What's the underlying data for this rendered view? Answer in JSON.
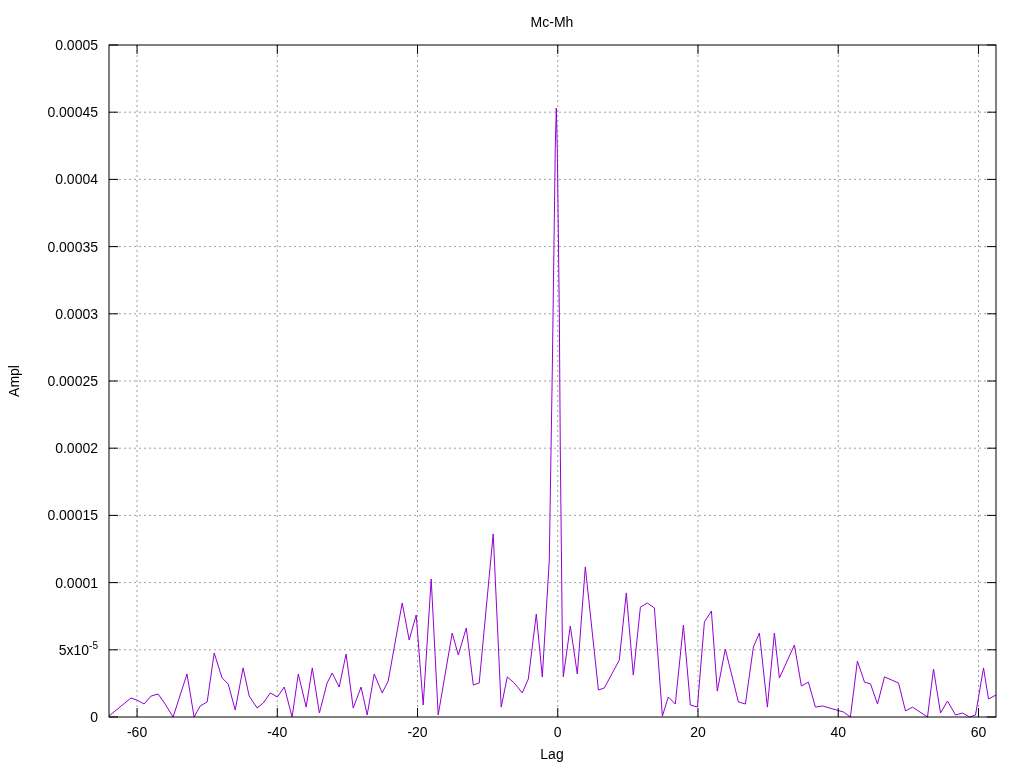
{
  "chart_data": {
    "type": "line",
    "title": "Mc-Mh",
    "xlabel": "Lag",
    "ylabel": "Ampl",
    "grid": true,
    "xlim": [
      -64,
      62.5
    ],
    "ylim": [
      0,
      0.0005
    ],
    "xticks": [
      -60,
      -40,
      -20,
      0,
      20,
      40,
      60
    ],
    "yticks": [
      0,
      {
        "value": 5e-05,
        "label": "5x10$^{-5}$"
      },
      {
        "value": 0.0001,
        "label": "0.0001"
      },
      {
        "value": 0.00015,
        "label": "0.00015"
      },
      {
        "value": 0.0002,
        "label": "0.0002"
      },
      {
        "value": 0.00025,
        "label": "0.00025"
      },
      {
        "value": 0.0003,
        "label": "0.0003"
      },
      {
        "value": 0.00035,
        "label": "0.00035"
      },
      {
        "value": 0.0004,
        "label": "0.0004"
      },
      {
        "value": 0.00045,
        "label": "0.00045"
      },
      {
        "value": 0.0005,
        "label": "0.0005"
      }
    ],
    "x": [
      -64,
      -60.86,
      -60,
      -59,
      -58,
      -57,
      -56,
      -54.86,
      -52.87,
      -51.87,
      -51,
      -50,
      -49,
      -47.87,
      -47,
      -46,
      -44.87,
      -44,
      -42.88,
      -42,
      -41,
      -40,
      -39,
      -37.88,
      -37,
      -35.88,
      -35,
      -34,
      -32.89,
      -32.17,
      -31.17,
      -30.18,
      -29.18,
      -28.04,
      -27.18,
      -26.18,
      -25.04,
      -24.18,
      -22.18,
      -21.18,
      -20.19,
      -19.19,
      -18.05,
      -17.05,
      -15.05,
      -14.19,
      -13.05,
      -12.05,
      -11.2,
      -9.2,
      -8.06,
      -7.2,
      -6.2,
      -5.06,
      -4.2,
      -3.06,
      -2.21,
      -1.21,
      -0.78,
      -0.64,
      -0.49,
      -0.35,
      -0.21,
      -0.07,
      0.08,
      0.22,
      0.36,
      0.65,
      0.79,
      1.79,
      2.79,
      3.93,
      5.79,
      6.64,
      8.78,
      9.78,
      10.78,
      11.78,
      12.78,
      13.78,
      14.92,
      15.77,
      16.77,
      17.92,
      18.91,
      19.91,
      20.91,
      21.91,
      22.76,
      23.9,
      25.76,
      26.76,
      27.9,
      28.76,
      29.9,
      30.9,
      31.61,
      33.75,
      34.75,
      35.75,
      36.75,
      37.75,
      39.75,
      40.75,
      41.74,
      42.74,
      43.74,
      44.6,
      45.6,
      46.6,
      48.6,
      49.6,
      50.59,
      52.73,
      53.59,
      54.59,
      55.59,
      56.73,
      57.73,
      58.72,
      59.58,
      60.72,
      61.43,
      62.5
    ],
    "series": [
      {
        "color": "#9400d3",
        "values": [
          7.4e-07,
          1.41e-05,
          1.26e-05,
          9.7e-06,
          1.56e-05,
          1.71e-05,
          9.7e-06,
          0,
          3.2e-05,
          0,
          8.2e-06,
          1.12e-05,
          4.76e-05,
          2.9e-05,
          2.46e-05,
          5.2e-06,
          3.65e-05,
          1.56e-05,
          6.7e-06,
          1.04e-05,
          1.79e-05,
          1.49e-05,
          2.23e-05,
          0,
          3.2e-05,
          7.4e-06,
          3.65e-05,
          3e-06,
          2.53e-05,
          3.27e-05,
          2.23e-05,
          4.69e-05,
          6.7e-06,
          2.23e-05,
          1.5e-06,
          3.2e-05,
          1.79e-05,
          2.68e-05,
          8.48e-05,
          5.73e-05,
          7.59e-05,
          8.9e-06,
          0.0001027,
          1.5e-06,
          6.25e-05,
          4.61e-05,
          6.62e-05,
          2.38e-05,
          2.53e-05,
          0.0001362,
          7.4e-06,
          2.98e-05,
          2.53e-05,
          1.79e-05,
          2.83e-05,
          7.66e-05,
          2.98e-05,
          0.0001168,
          0.0002582,
          0.000314,
          0.000369,
          0.0004248,
          0.0004531,
          0.0004226,
          0.0003623,
          0.0003013,
          0.0001986,
          5.95e-05,
          2.98e-05,
          6.77e-05,
          3.2e-05,
          0.0001116,
          2.01e-05,
          2.16e-05,
          4.24e-05,
          9.23e-05,
          3.12e-05,
          8.18e-05,
          8.48e-05,
          8.11e-05,
          7e-07,
          1.49e-05,
          9.7e-06,
          6.84e-05,
          8.9e-06,
          7.4e-06,
          7.07e-05,
          7.89e-05,
          1.93e-05,
          5.06e-05,
          1.12e-05,
          9.7e-06,
          5.21e-05,
          6.25e-05,
          7.4e-06,
          6.25e-05,
          2.9e-05,
          5.36e-05,
          2.31e-05,
          2.6e-05,
          7.4e-06,
          8.2e-06,
          5.2e-06,
          3.7e-06,
          0,
          4.17e-05,
          2.6e-05,
          2.46e-05,
          9.7e-06,
          2.98e-05,
          2.53e-05,
          4.5e-06,
          7.4e-06,
          0,
          3.57e-05,
          3e-06,
          1.19e-05,
          1.5e-06,
          3e-06,
          0,
          1.5e-06,
          3.65e-05,
          1.34e-05,
          1.64e-05
        ]
      }
    ]
  }
}
